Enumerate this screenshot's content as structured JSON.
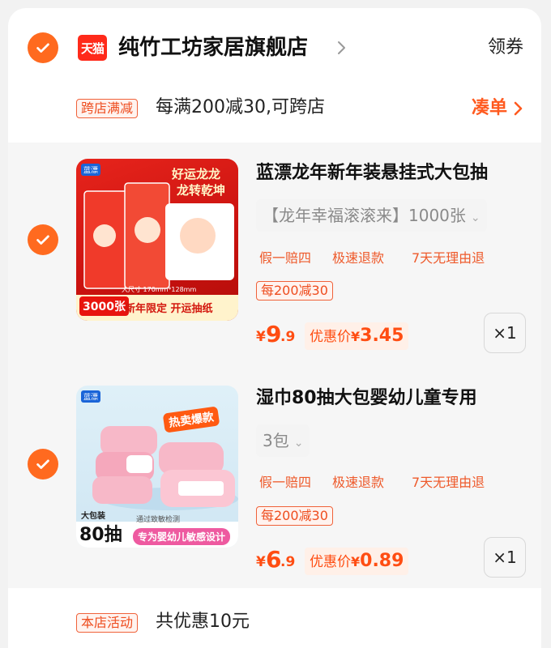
{
  "shop": {
    "badge": "天猫",
    "name": "纯竹工坊家居旗舰店",
    "coupon_label": "领券"
  },
  "promo": {
    "tag": "跨店满减",
    "text": "每满200减30,可跨店",
    "action": "凑单"
  },
  "products": [
    {
      "title": "蓝漂龙年新年装悬挂式大包抽",
      "sku": "【龙年幸福滚滚来】1000张",
      "services": [
        "假一赔四",
        "极速退款",
        "7天无理由退"
      ],
      "promo_tag": "每200减30",
      "price_symbol": "¥",
      "price_int": "9",
      "price_dec": ".9",
      "discount_label": "优惠价",
      "discount_symbol": "¥",
      "discount_price": "3.45",
      "quantity": "×1",
      "image": {
        "banner": "好运龙龙",
        "banner2": "龙转乾坤",
        "size_text": "大尺寸 170mm*128mm",
        "count": "3000张",
        "caption": "新年限定 开运抽纸",
        "brand": "蓝漂"
      }
    },
    {
      "title": "湿巾80抽大包婴幼儿童专用",
      "sku": "3包",
      "services": [
        "假一赔四",
        "极速退款",
        "7天无理由退"
      ],
      "promo_tag": "每200减30",
      "price_symbol": "¥",
      "price_int": "6",
      "price_dec": ".9",
      "discount_label": "优惠价",
      "discount_symbol": "¥",
      "discount_price": "0.89",
      "quantity": "×1",
      "image": {
        "badge": "热卖爆款",
        "pack_label": "大包装",
        "count": "80抽",
        "tested": "通过致敏检测",
        "caption": "专为婴幼儿敏感设计",
        "brand": "蓝漂"
      }
    }
  ],
  "store_activity": {
    "tag": "本店活动",
    "text": "共优惠10元"
  },
  "colors": {
    "accent": "#ff6a1f",
    "price": "#ff4d12",
    "tmall_red": "#ff2a1a"
  }
}
